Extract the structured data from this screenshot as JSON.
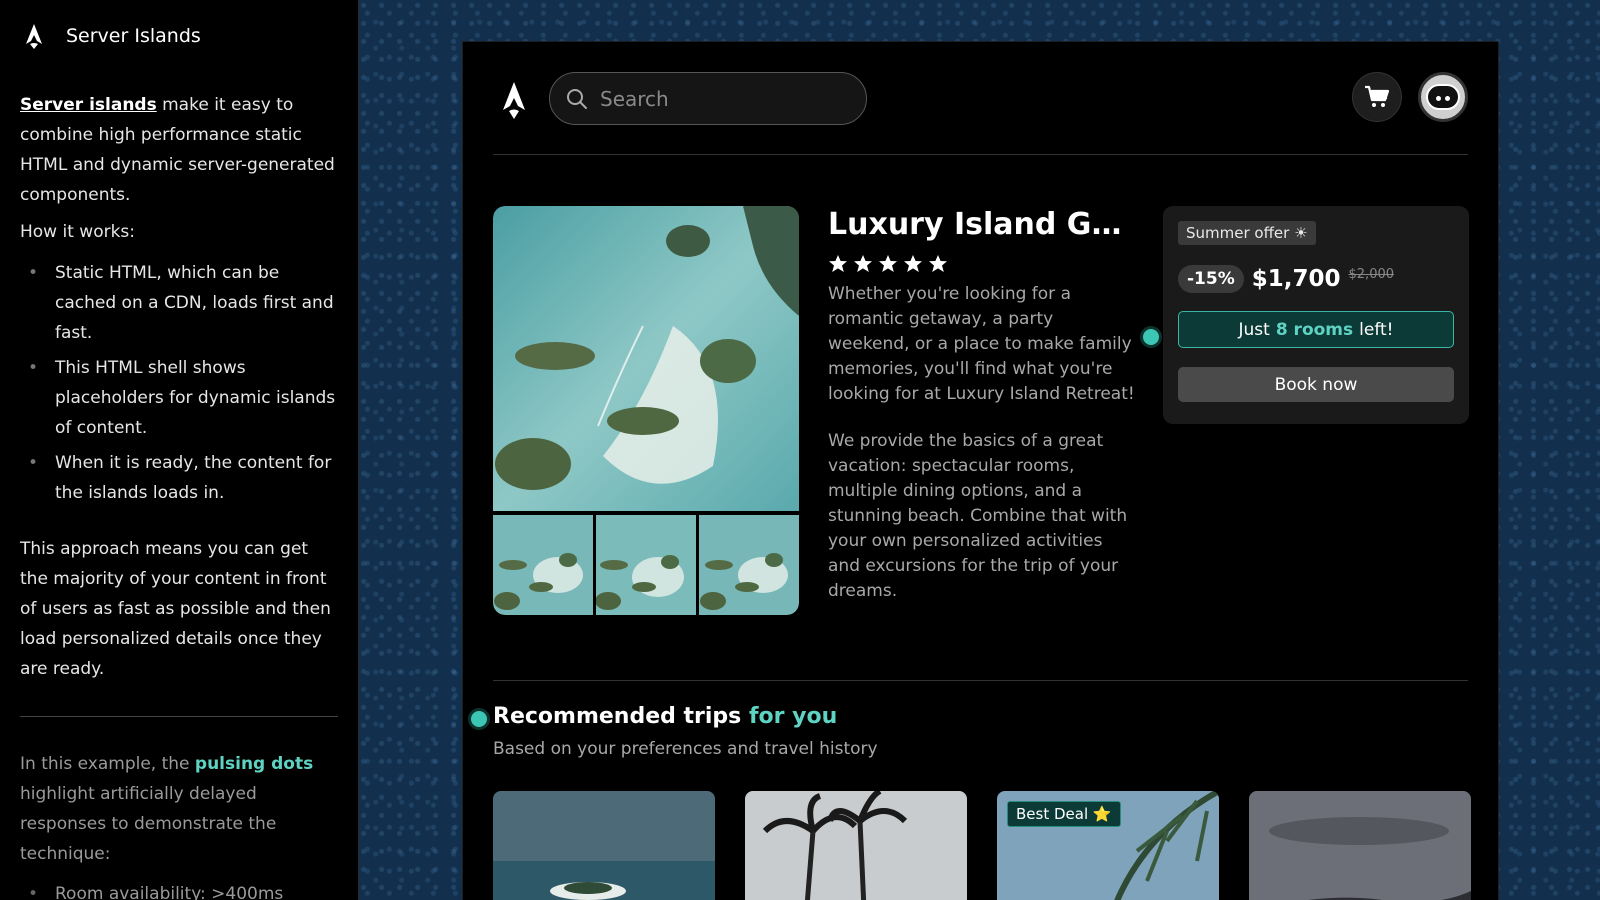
{
  "sidebar": {
    "title": "Server Islands",
    "intro_link": "Server islands",
    "intro_text": " make it easy to combine high performance static HTML and dynamic server-generated components.",
    "how_it_works": "How it works:",
    "steps": [
      "Static HTML, which can be cached on a CDN, loads first and fast.",
      "This HTML shell shows placeholders for dynamic islands of content.",
      "When it is ready, the content for the islands loads in."
    ],
    "approach": "This approach means you can get the majority of your content in front of users as fast as possible and then load personalized details once they are ready.",
    "example_prefix": "In this example, the ",
    "example_highlight": "pulsing dots",
    "example_suffix": " highlight artificially delayed responses to demonstrate the technique:",
    "delays": [
      "Room availability: >400ms"
    ]
  },
  "header": {
    "search_placeholder": "Search"
  },
  "product": {
    "title": "Luxury Island Get...",
    "rating": 5,
    "description_1": "Whether you're looking for a romantic getaway, a party weekend, or a place to make family memories, you'll find what you're looking for at Luxury Island Retreat!",
    "description_2": "We provide the basics of a great vacation: spectacular rooms, multiple dining options, and a stunning beach. Combine that with your own personalized activities and excursions for the trip of your dreams."
  },
  "offer": {
    "badge": "Summer offer ☀",
    "discount": "-15%",
    "price": "$1,700",
    "old_price": "$2,000",
    "rooms_prefix": "Just ",
    "rooms_count": "8 rooms",
    "rooms_suffix": " left!",
    "book_label": "Book now"
  },
  "recommended": {
    "title": "Recommended trips ",
    "title_highlight": "for you",
    "subtitle": "Based on your preferences and travel history",
    "cards": [
      {
        "badge": ""
      },
      {
        "badge": ""
      },
      {
        "badge": "Best Deal ⭐"
      },
      {
        "badge": ""
      }
    ]
  },
  "colors": {
    "accent": "#5fd3c3",
    "dot": "#3cc7b4",
    "background": "#12304d"
  }
}
